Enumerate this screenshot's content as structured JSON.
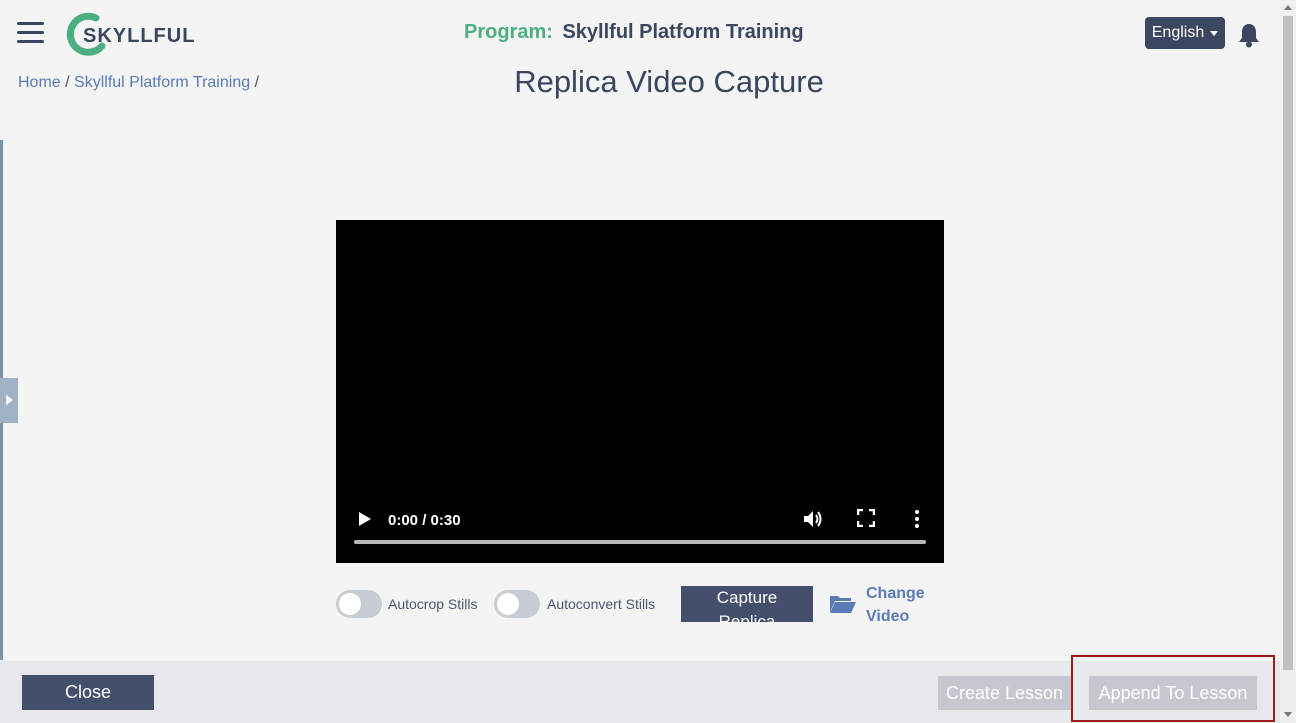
{
  "header": {
    "logo_text": "SKYLLFUL",
    "program_label": "Program:",
    "program_name": "Skyllful Platform Training",
    "language": "English"
  },
  "breadcrumb": {
    "home": "Home",
    "separator": "/",
    "program": "Skyllful Platform Training"
  },
  "page_title": "Replica Video Capture",
  "video": {
    "time": "0:00 / 0:30"
  },
  "options": {
    "autocrop_label": "Autocrop Stills",
    "autocrop_on": false,
    "autoconvert_label": "Autoconvert Stills",
    "autoconvert_on": false
  },
  "actions": {
    "capture_line1": "Capture",
    "capture_line2": "Replica",
    "change_line1": "Change",
    "change_line2": "Video"
  },
  "footer": {
    "close": "Close",
    "create_lesson": "Create Lesson",
    "append_to_lesson": "Append To Lesson"
  },
  "colors": {
    "primary": "#44506b",
    "accent_green": "#4caf82",
    "link": "#5a7bb5",
    "disabled": "#c5c8cf",
    "highlight": "#a01c1c"
  }
}
